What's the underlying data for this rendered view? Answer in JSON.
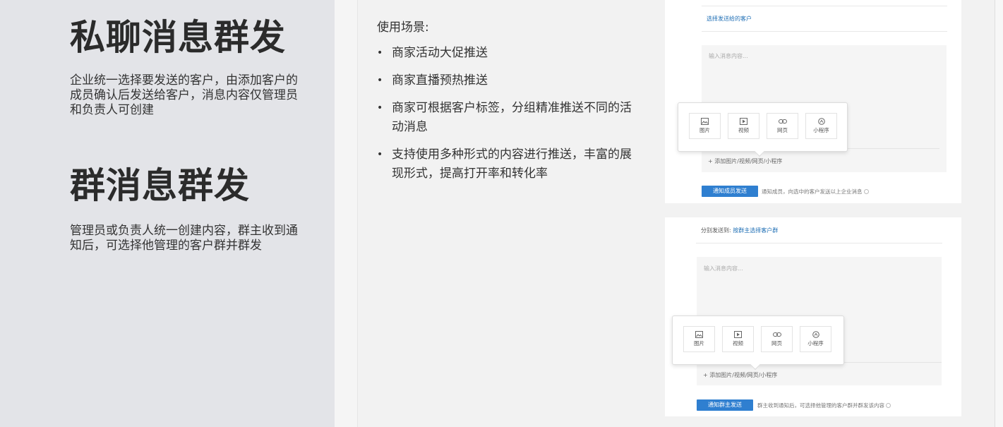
{
  "left": {
    "private": {
      "title": "私聊消息群发",
      "desc": "企业统一选择要发送的客户，由添加客户的成员确认后发送给客户，消息内容仅管理员和负责人可创建"
    },
    "group": {
      "title": "群消息群发",
      "desc": "管理员或负责人统一创建内容，群主收到通知后，可选择他管理的客户群并群发"
    }
  },
  "scenarios": {
    "heading": "使用场景:",
    "bullet": "•",
    "items": [
      "商家活动大促推送",
      "商家直播预热推送",
      "商家可根据客户标签，分组精准推送不同的活动消息",
      "支持使用多种形式的内容进行推送，丰富的展现形式，提高打开率和转化率"
    ]
  },
  "shot1": {
    "select_customers": "选择发送给的客户",
    "placeholder": "输入消息内容...",
    "attach_types": [
      "图片",
      "视频",
      "网页",
      "小程序"
    ],
    "add_attachment": "+ 添加图片/视频/网页/小程序",
    "send_button": "通知成员发送",
    "hint": "通知成员，向选中的客户发送以上企业消息"
  },
  "shot2": {
    "send_to_label": "分别发送到:",
    "send_to_link": "按群主选择客户群",
    "placeholder": "输入消息内容...",
    "attach_types": [
      "图片",
      "视频",
      "网页",
      "小程序"
    ],
    "add_attachment": "+ 添加图片/视频/网页/小程序",
    "send_button": "通知群主发送",
    "hint": "群主收到通知后，可选择他管理的客户群并群发该内容"
  },
  "colors": {
    "left_panel": "#e3e4e8",
    "accent_blue": "#2f7fd0",
    "link_blue": "#1f6fb5"
  }
}
